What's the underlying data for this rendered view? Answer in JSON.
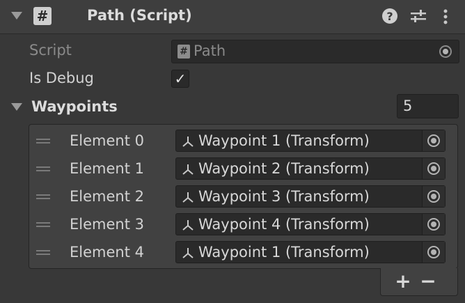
{
  "component": {
    "title": "Path (Script)",
    "enabled_glyph": "#",
    "help_glyph": "?",
    "icons": [
      "foldout-arrow-icon",
      "help-icon",
      "preset-icon",
      "menu-kebab-icon"
    ]
  },
  "script": {
    "label": "Script",
    "value": "Path",
    "icon": "#"
  },
  "is_debug": {
    "label": "Is Debug",
    "checked": true,
    "check_glyph": "✓"
  },
  "waypoints": {
    "label": "Waypoints",
    "size": "5",
    "elements": [
      {
        "label": "Element 0",
        "value": "Waypoint 1 (Transform)"
      },
      {
        "label": "Element 1",
        "value": "Waypoint 2 (Transform)"
      },
      {
        "label": "Element 2",
        "value": "Waypoint 3 (Transform)"
      },
      {
        "label": "Element 3",
        "value": "Waypoint 4 (Transform)"
      },
      {
        "label": "Element 4",
        "value": "Waypoint 1 (Transform)"
      }
    ],
    "add_label": "+",
    "remove_label": "−"
  },
  "colors": {
    "background": "#383838",
    "header": "#3e3e3e",
    "field": "#2a2a2a",
    "text": "#d2d2d2",
    "disabled_text": "#8a8a8a"
  }
}
